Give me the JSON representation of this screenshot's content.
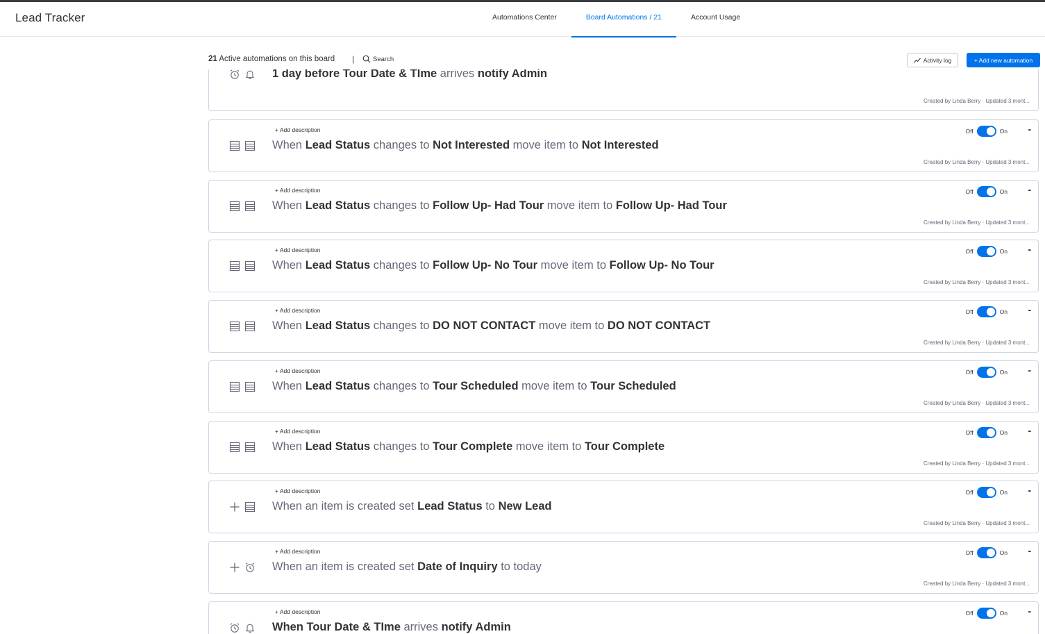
{
  "header": {
    "board_title": "Lead Tracker",
    "tabs": [
      {
        "label": "Automations Center"
      },
      {
        "label": "Board Automations / 21"
      },
      {
        "label": "Account Usage"
      }
    ]
  },
  "toolbar": {
    "count": "21",
    "count_label": " Active automations on this board",
    "separator": "|",
    "search_label": "Search",
    "activity_log_label": "Activity log",
    "add_label": "+ Add new automation"
  },
  "automations": [
    {
      "icons": [
        "alarm-icon",
        "bell-icon"
      ],
      "description": "",
      "parts": [
        {
          "text": "1 day before ",
          "bold": true
        },
        {
          "text": "Tour Date & TIme ",
          "bold": true
        },
        {
          "text": "arrives ",
          "bold": false
        },
        {
          "text": "notify ",
          "bold": true
        },
        {
          "text": "Admin",
          "bold": true
        }
      ],
      "meta": "Created by Linda Berry · Updated 3 mont..."
    },
    {
      "icons": [
        "table-icon",
        "table-icon"
      ],
      "description": "+ Add description",
      "toggle_off": "Off",
      "toggle_on": "On",
      "parts": [
        {
          "text": "When ",
          "bold": false
        },
        {
          "text": "Lead Status ",
          "bold": true
        },
        {
          "text": "changes to ",
          "bold": false
        },
        {
          "text": "Not Interested ",
          "bold": true
        },
        {
          "text": "move item to ",
          "bold": false
        },
        {
          "text": "Not Interested",
          "bold": true
        }
      ],
      "meta": "Created by Linda Berry · Updated 3 mont..."
    },
    {
      "icons": [
        "table-icon",
        "table-icon"
      ],
      "description": "+ Add description",
      "toggle_off": "Off",
      "toggle_on": "On",
      "parts": [
        {
          "text": "When ",
          "bold": false
        },
        {
          "text": "Lead Status ",
          "bold": true
        },
        {
          "text": "changes to ",
          "bold": false
        },
        {
          "text": "Follow Up- Had Tour ",
          "bold": true
        },
        {
          "text": "move item to ",
          "bold": false
        },
        {
          "text": "Follow Up- Had Tour",
          "bold": true
        }
      ],
      "meta": "Created by Linda Berry · Updated 3 mont..."
    },
    {
      "icons": [
        "table-icon",
        "table-icon"
      ],
      "description": "+ Add description",
      "toggle_off": "Off",
      "toggle_on": "On",
      "parts": [
        {
          "text": "When ",
          "bold": false
        },
        {
          "text": "Lead Status ",
          "bold": true
        },
        {
          "text": "changes to ",
          "bold": false
        },
        {
          "text": "Follow Up- No Tour ",
          "bold": true
        },
        {
          "text": "move item to ",
          "bold": false
        },
        {
          "text": "Follow Up- No Tour",
          "bold": true
        }
      ],
      "meta": "Created by Linda Berry · Updated 3 mont..."
    },
    {
      "icons": [
        "table-icon",
        "table-icon"
      ],
      "description": "+ Add description",
      "toggle_off": "Off",
      "toggle_on": "On",
      "parts": [
        {
          "text": "When ",
          "bold": false
        },
        {
          "text": "Lead Status ",
          "bold": true
        },
        {
          "text": "changes to ",
          "bold": false
        },
        {
          "text": "DO NOT CONTACT ",
          "bold": true
        },
        {
          "text": "move item to ",
          "bold": false
        },
        {
          "text": "DO NOT CONTACT",
          "bold": true
        }
      ],
      "meta": "Created by Linda Berry · Updated 3 mont..."
    },
    {
      "icons": [
        "table-icon",
        "table-icon"
      ],
      "description": "+ Add description",
      "toggle_off": "Off",
      "toggle_on": "On",
      "parts": [
        {
          "text": "When ",
          "bold": false
        },
        {
          "text": "Lead Status ",
          "bold": true
        },
        {
          "text": "changes to ",
          "bold": false
        },
        {
          "text": "Tour Scheduled ",
          "bold": true
        },
        {
          "text": "move item to ",
          "bold": false
        },
        {
          "text": "Tour Scheduled",
          "bold": true
        }
      ],
      "meta": "Created by Linda Berry · Updated 3 mont..."
    },
    {
      "icons": [
        "table-icon",
        "table-icon"
      ],
      "description": "+ Add description",
      "toggle_off": "Off",
      "toggle_on": "On",
      "parts": [
        {
          "text": "When ",
          "bold": false
        },
        {
          "text": "Lead Status ",
          "bold": true
        },
        {
          "text": "changes to ",
          "bold": false
        },
        {
          "text": "Tour Complete ",
          "bold": true
        },
        {
          "text": "move item to ",
          "bold": false
        },
        {
          "text": "Tour Complete",
          "bold": true
        }
      ],
      "meta": "Created by Linda Berry · Updated 3 mont..."
    },
    {
      "icons": [
        "plus-icon",
        "table-icon"
      ],
      "description": "+ Add description",
      "toggle_off": "Off",
      "toggle_on": "On",
      "parts": [
        {
          "text": "When an item is created set ",
          "bold": false
        },
        {
          "text": "Lead Status ",
          "bold": true
        },
        {
          "text": "to ",
          "bold": false
        },
        {
          "text": "New Lead",
          "bold": true
        }
      ],
      "meta": "Created by Linda Berry · Updated 3 mont..."
    },
    {
      "icons": [
        "plus-icon",
        "alarm-icon"
      ],
      "description": "+ Add description",
      "toggle_off": "Off",
      "toggle_on": "On",
      "parts": [
        {
          "text": "When an item is created set ",
          "bold": false
        },
        {
          "text": "Date of Inquiry ",
          "bold": true
        },
        {
          "text": "to today",
          "bold": false
        }
      ],
      "meta": "Created by Linda Berry · Updated 3 mont..."
    },
    {
      "icons": [
        "alarm-icon",
        "bell-icon"
      ],
      "description": "+ Add description",
      "toggle_off": "Off",
      "toggle_on": "On",
      "parts": [
        {
          "text": "When ",
          "bold": true
        },
        {
          "text": "Tour Date & TIme ",
          "bold": true
        },
        {
          "text": "arrives ",
          "bold": false
        },
        {
          "text": "notify ",
          "bold": true
        },
        {
          "text": "Admin",
          "bold": true
        }
      ],
      "meta": ""
    }
  ]
}
